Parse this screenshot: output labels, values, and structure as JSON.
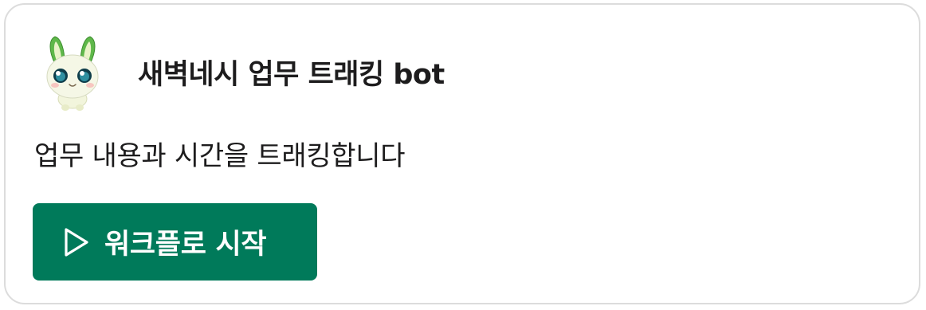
{
  "bot": {
    "avatar_icon": "bot-mascot-avatar",
    "name": "새벽네시 업무 트래킹 bot"
  },
  "message": {
    "description": "업무 내용과 시간을 트래킹합니다"
  },
  "actions": {
    "start_workflow_label": "워크플로 시작",
    "start_workflow_icon": "play-icon",
    "button_color": "#007a5a"
  }
}
